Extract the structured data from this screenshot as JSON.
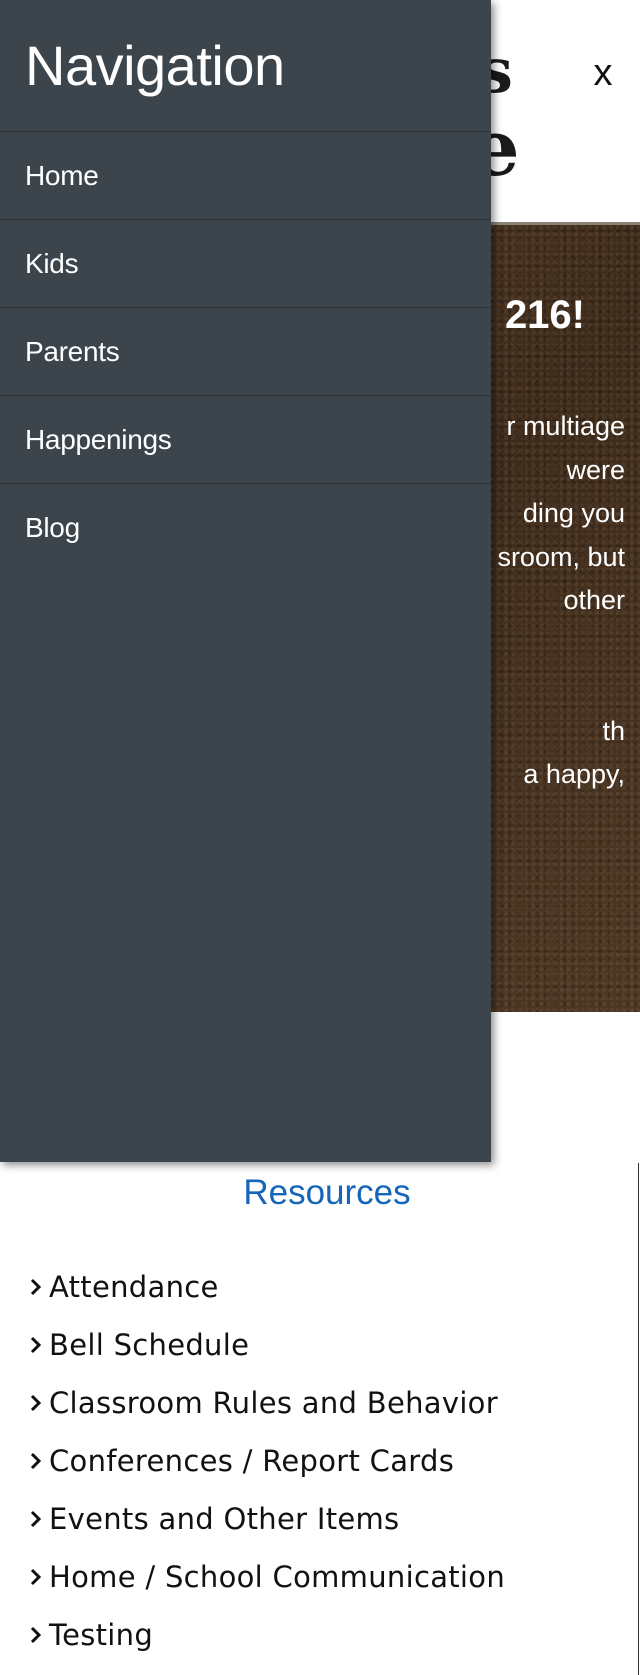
{
  "header": {
    "logo_fragment_1": "s",
    "logo_fragment_2": "e",
    "close_label": "x"
  },
  "hero": {
    "title_fragment": "216!",
    "body_lines": [
      "r multiage",
      " were",
      "ding you",
      "sroom, but",
      "other",
      "th",
      "a happy,"
    ]
  },
  "navigation": {
    "title": "Navigation",
    "items": [
      {
        "label": "Home"
      },
      {
        "label": "Kids"
      },
      {
        "label": "Parents"
      },
      {
        "label": "Happenings"
      },
      {
        "label": "Blog"
      }
    ]
  },
  "resources": {
    "title": "Resources",
    "items": [
      {
        "label": "Attendance"
      },
      {
        "label": "Bell Schedule"
      },
      {
        "label": "Classroom Rules and Behavior"
      },
      {
        "label": "Conferences / Report Cards"
      },
      {
        "label": "Events and Other Items"
      },
      {
        "label": "Home / School Communication"
      },
      {
        "label": "Testing"
      }
    ]
  },
  "colors": {
    "drawer_background": "#3c454c",
    "resources_title": "#1565b8",
    "hero_background": "#4a3320"
  },
  "icons": {
    "resource_bullet": "chevron-right-icon",
    "close": "close-icon"
  }
}
